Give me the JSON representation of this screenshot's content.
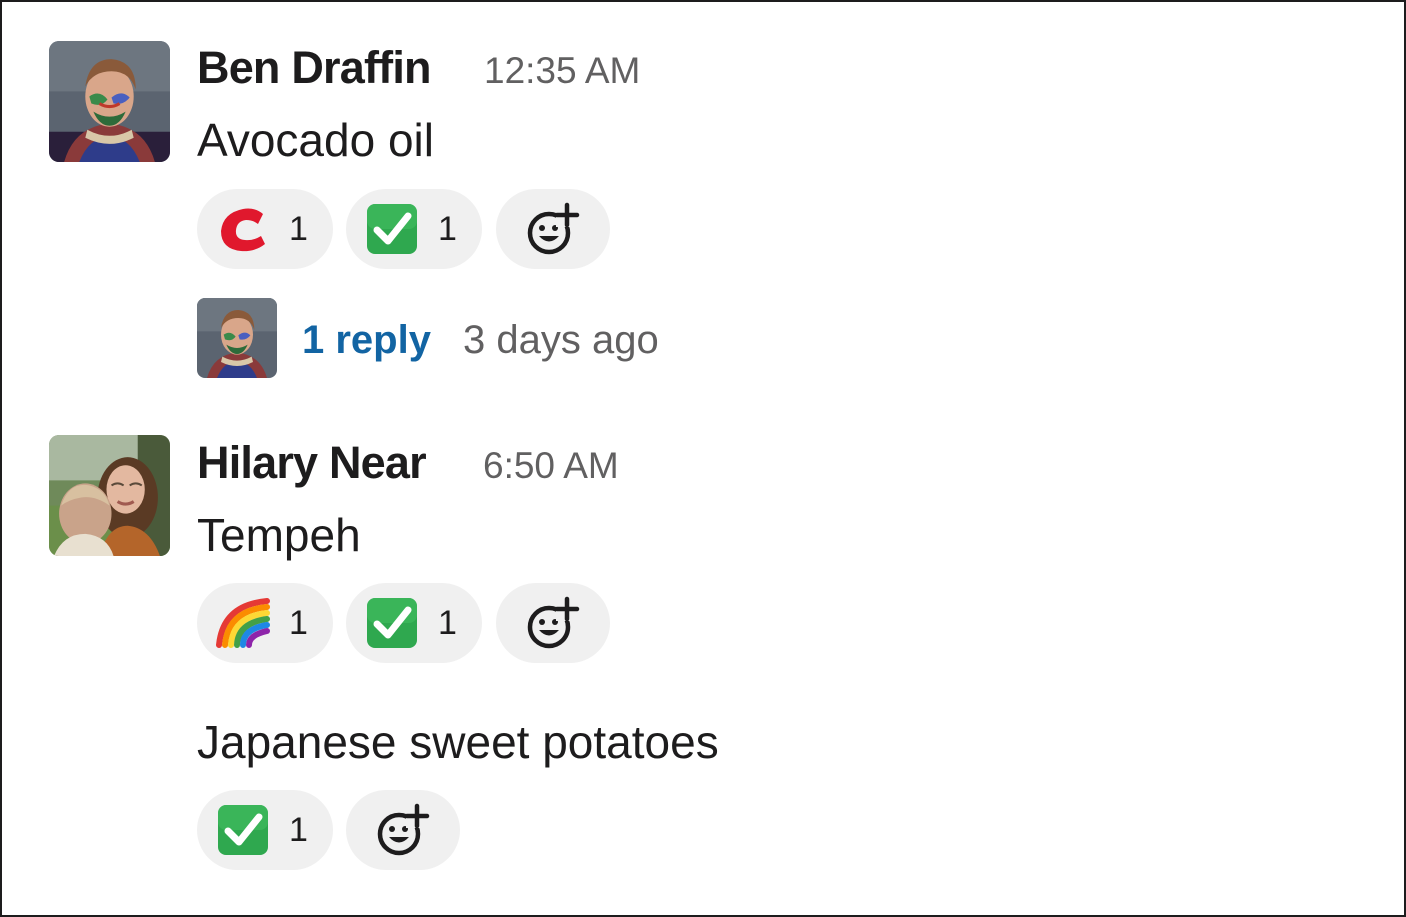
{
  "messages": [
    {
      "author": "Ben Draffin",
      "time": "12:35 AM",
      "text": "Avocado oil",
      "reactions": [
        {
          "emoji": "red-c-logo",
          "count": "1"
        },
        {
          "emoji": "white-check-mark",
          "count": "1"
        }
      ],
      "thread": {
        "reply_label": "1 reply",
        "reply_time": "3 days ago"
      }
    },
    {
      "author": "Hilary Near",
      "time": "6:50 AM",
      "text": "Tempeh",
      "reactions": [
        {
          "emoji": "rainbow",
          "count": "1"
        },
        {
          "emoji": "white-check-mark",
          "count": "1"
        }
      ]
    },
    {
      "author": "Hilary Near",
      "text": "Japanese sweet potatoes",
      "reactions": [
        {
          "emoji": "white-check-mark",
          "count": "1"
        }
      ]
    }
  ],
  "colors": {
    "link": "#1264a3",
    "reaction_bg": "#f0f0f0",
    "timestamp": "#616061",
    "check_green": "#2fa84f",
    "red_logo": "#e0182d"
  }
}
